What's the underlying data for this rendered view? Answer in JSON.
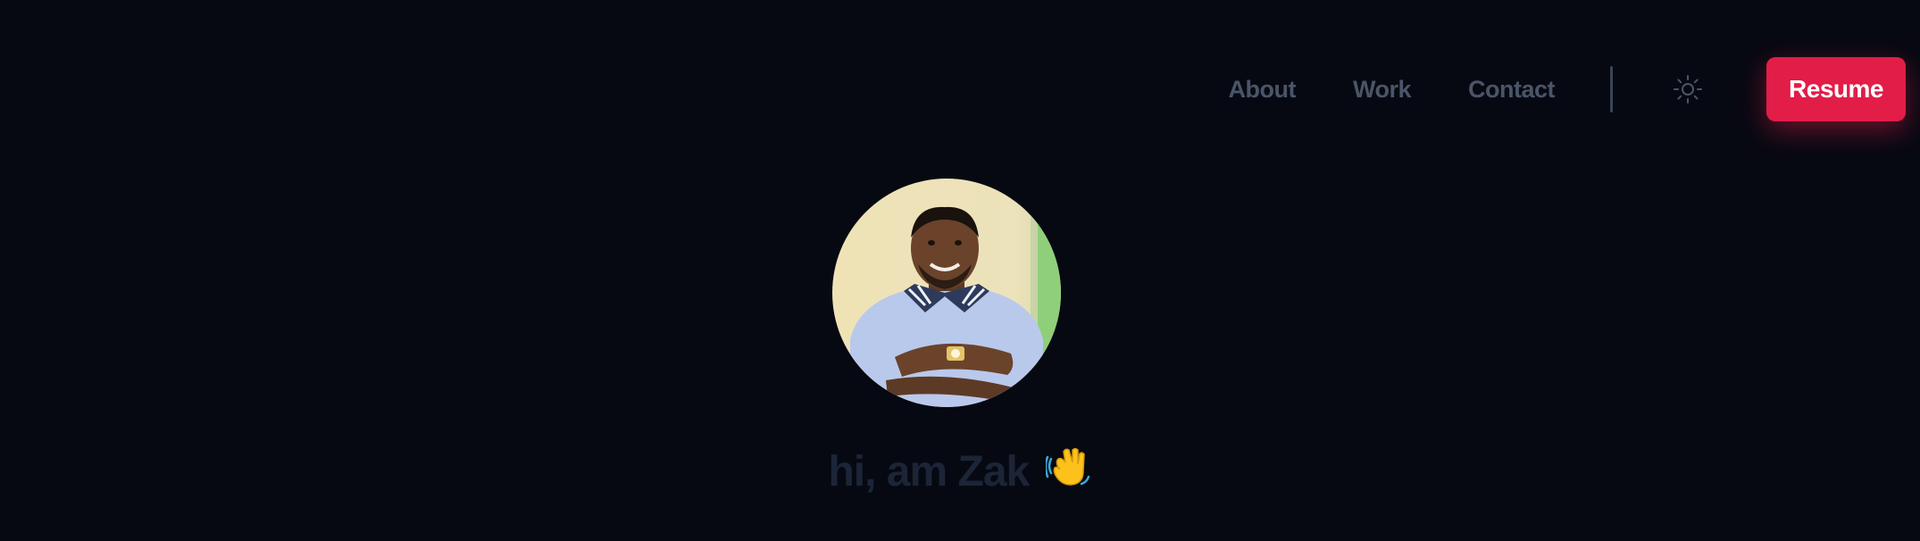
{
  "nav": {
    "links": [
      {
        "label": "About"
      },
      {
        "label": "Work"
      },
      {
        "label": "Contact"
      }
    ],
    "theme_toggle_icon": "sun-icon",
    "resume_label": "Resume"
  },
  "hero": {
    "avatar_alt": "profile-photo",
    "greeting": "hi, am Zak",
    "greeting_emoji": "waving-hand-icon"
  },
  "colors": {
    "background": "#070912",
    "nav_text": "#4a5568",
    "accent": "#e11d48",
    "greeting_text": "#1c2537"
  }
}
